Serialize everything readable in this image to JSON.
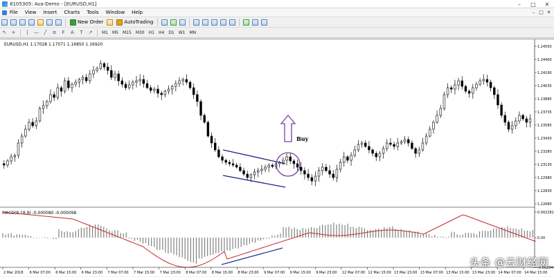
{
  "window": {
    "title": "8105305: Ava-Demo - [EURUSD,H1]"
  },
  "window_controls": [
    "–",
    "□",
    "✕"
  ],
  "mdi_controls": [
    "–",
    "□",
    "✕"
  ],
  "menu": [
    "File",
    "View",
    "Insert",
    "Charts",
    "Tools",
    "Window",
    "Help"
  ],
  "toolbar": {
    "new_order": "New Order",
    "autotrading": "AutoTrading"
  },
  "timeframes": [
    "M1",
    "M5",
    "M15",
    "M30",
    "H1",
    "H4",
    "D1",
    "W1",
    "MN"
  ],
  "chart": {
    "symbol_line": "EURUSD,H1  1.17028 1.17071 1.16850 1.16920",
    "macd_label": "MACD(8,18,9) -0.000080 -0.000098",
    "buy_label": "Buy",
    "price_ticks": [
      "1.24550",
      "1.24400",
      "1.24190",
      "1.24035",
      "1.23885",
      "1.23735",
      "1.23585",
      "1.23430",
      "1.23280",
      "1.23130",
      "1.22980",
      "1.22830",
      "1.22680"
    ],
    "macd_ticks": [
      "0.002281",
      "0.00",
      "-0.002944"
    ],
    "time_labels": [
      "2 Mar 2018",
      "6 Mar 07:00",
      "6 Mar 15:00",
      "6 Mar 23:00",
      "7 Mar 07:00",
      "7 Mar 15:00",
      "7 Mar 23:00",
      "8 Mar 07:00",
      "8 Mar 15:00",
      "8 Mar 23:00",
      "9 Mar 07:00",
      "9 Mar 15:00",
      "9 Mar 23:00",
      "12 Mar 07:00",
      "12 Mar 15:00",
      "13 Mar 23:00",
      "13 Mar 07:00",
      "13 Mar 15:00",
      "13 Mar 23:00",
      "14 Mar 07:00",
      "14 Mar 15:00"
    ],
    "colors": {
      "candle": "#000000",
      "channel": "#1a237e",
      "buy_arrow": "#7b3fa0",
      "macd_signal": "#c62828",
      "macd_hist": "#808080",
      "divergence": "#283593"
    }
  },
  "watermark": "头条 @云财经网"
}
